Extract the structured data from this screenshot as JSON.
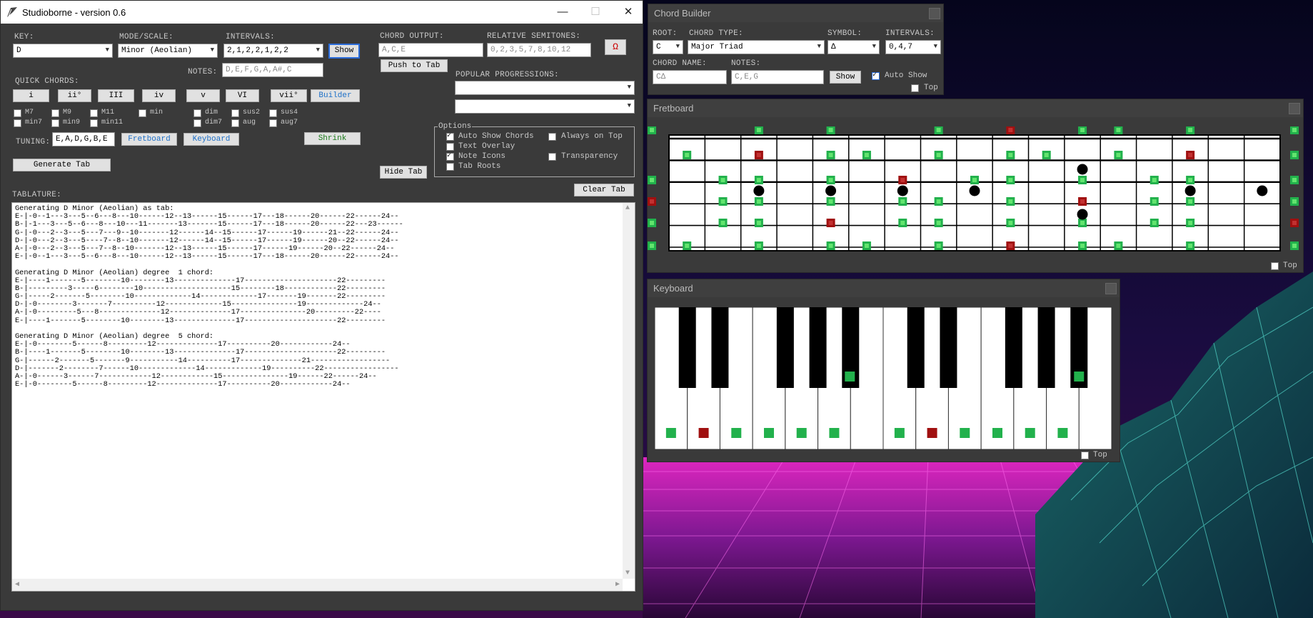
{
  "main_window": {
    "title": "Studioborne - version 0.6",
    "min": "—",
    "max": "☐",
    "close": "✕",
    "key_label": "KEY:",
    "key_value": "D",
    "mode_label": "MODE/SCALE:",
    "mode_value": "Minor (Aeolian)",
    "intervals_label": "INTERVALS:",
    "intervals_value": "2,1,2,2,1,2,2",
    "show_button": "Show",
    "notes_label": "NOTES:",
    "notes_value": "D,E,F,G,A,A#,C",
    "chord_output_label": "CHORD OUTPUT:",
    "chord_output_value": "A,C,E",
    "rel_semitones_label": "RELATIVE SEMITONES:",
    "rel_semitones_value": "0,2,3,5,7,8,10,12",
    "omega_button": "Ω",
    "push_to_tab": "Push to Tab",
    "quick_chords_label": "QUICK CHORDS:",
    "quick_chords": [
      "i",
      "ii°",
      "III",
      "iv",
      "v",
      "VI",
      "vii°"
    ],
    "builder_button": "Builder",
    "popular_progressions_label": "POPULAR PROGRESSIONS:",
    "ext_row1": [
      "M7",
      "M9",
      "M11",
      "min",
      "dim",
      "sus2",
      "sus4"
    ],
    "ext_row2": [
      "min7",
      "min9",
      "min11",
      "dim7",
      "aug",
      "aug7"
    ],
    "tuning_label": "TUNING:",
    "tuning_value": "E,A,D,G,B,E",
    "fretboard_button": "Fretboard",
    "keyboard_button": "Keyboard",
    "shrink_button": "Shrink",
    "generate_tab": "Generate Tab",
    "hide_tab": "Hide Tab",
    "clear_tab": "Clear Tab",
    "tablature_label": "TABLATURE:",
    "options_legend": "Options",
    "options": {
      "auto_show": "Auto Show Chords",
      "always_on_top": "Always on Top",
      "text_overlay": "Text Overlay",
      "transparency": "Transparency",
      "note_icons": "Note Icons",
      "tab_roots": "Tab Roots"
    }
  },
  "tab_lines": [
    "Generating D Minor (Aeolian) as tab:",
    "E-|-0--1---3---5--6---8---10------12--13------15------17---18------20------22------24--",
    "B-|-1---3---5--6---8---10---11-------13-------15------17---18------20------22---23------",
    "G-|-0---2--3---5---7---9--10-------12------14--15------17------19------21--22------24--",
    "D-|-0---2--3---5----7--8--10-------12------14--15------17------19------20--22------24--",
    "A-|-0---2--3---5---7--8--10-------12--13------15------17------19------20--22------24--",
    "E-|-0--1---3---5--6---8---10------12--13------15------17---18------20------22------24--",
    "",
    "Generating D Minor (Aeolian) degree  1 chord:",
    "E-|----1-------5--------10--------13--------------17---------------------22---------",
    "B-|---------3-----6--------10--------------------15--------18------------22---------",
    "G-|-----2-------5--------10-------------14-------------17-------19-------22---------",
    "D-|-0--------3-------7----------12-------------15---------------19-------------24--",
    "A-|-0---------5---8--------------12--------------17---------------20---------22----",
    "E-|----1-------5--------10--------13--------------17---------------------22---------",
    "",
    "Generating D Minor (Aeolian) degree  5 chord:",
    "E-|-0--------5------8---------12--------------17----------20------------24--",
    "B-|----1-------5--------10--------13--------------17---------------------22---------",
    "G-|------2-------5-------9-----------14----------17--------------21------------------",
    "D-|-------2--------7------10-------------14-------------19----------22-----------------",
    "A-|-0------3------7------------12------------15---------------19------22------24--",
    "E-|-0--------5------8---------12--------------17----------20------------24--"
  ],
  "chord_builder": {
    "title": "Chord Builder",
    "root_label": "ROOT:",
    "root_value": "C",
    "chord_type_label": "CHORD TYPE:",
    "chord_type_value": "Major Triad",
    "symbol_label": "SYMBOL:",
    "symbol_value": "Δ",
    "intervals_label": "INTERVALS:",
    "intervals_value": "0,4,7",
    "chord_name_label": "CHORD NAME:",
    "chord_name_value": "CΔ",
    "notes_label": "NOTES:",
    "notes_value": "C,E,G",
    "show_button": "Show",
    "auto_show": "Auto Show",
    "top": "Top"
  },
  "fretboard": {
    "title": "Fretboard",
    "top": "Top"
  },
  "keyboard": {
    "title": "Keyboard",
    "top": "Top"
  },
  "colors": {
    "panel": "#3a3a3a",
    "note_green": "#22b14c",
    "root_red": "#a01010",
    "accent_blue": "#1e70c8"
  }
}
